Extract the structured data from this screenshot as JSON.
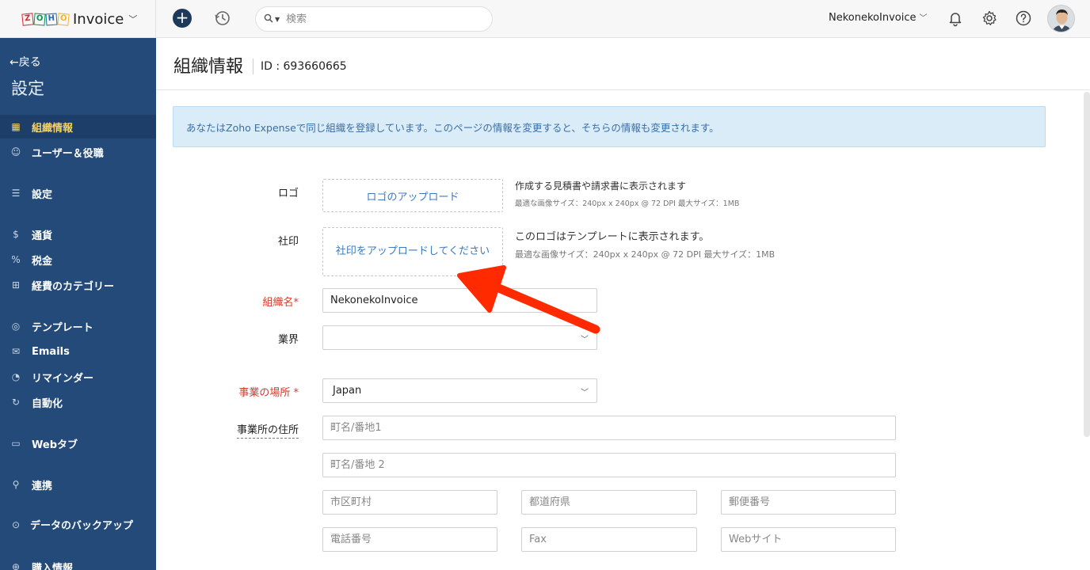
{
  "app": {
    "logo_letters": [
      "Z",
      "O",
      "H",
      "O"
    ],
    "name": "Invoice",
    "org_name": "NekonekoInvoice"
  },
  "topbar": {
    "search_placeholder": "検索"
  },
  "sidebar": {
    "back_label": "←戻る",
    "title": "設定",
    "items": [
      {
        "label": "組織情報",
        "icon": "building-icon",
        "active": true
      },
      {
        "label": "ユーザー＆役職",
        "icon": "users-icon"
      },
      {
        "label": "設定",
        "icon": "sliders-icon"
      },
      {
        "label": "通貨",
        "icon": "currency-icon"
      },
      {
        "label": "税金",
        "icon": "percent-icon"
      },
      {
        "label": "経費のカテゴリー",
        "icon": "category-icon"
      },
      {
        "label": "テンプレート",
        "icon": "template-icon"
      },
      {
        "label": "Emails",
        "icon": "mail-icon"
      },
      {
        "label": "リマインダー",
        "icon": "bell-icon"
      },
      {
        "label": "自動化",
        "icon": "refresh-icon"
      },
      {
        "label": "Webタブ",
        "icon": "window-icon"
      },
      {
        "label": "連携",
        "icon": "plug-icon"
      },
      {
        "label": "データのバックアップ",
        "icon": "backup-icon"
      },
      {
        "label": "購入情報",
        "icon": "cart-icon"
      }
    ]
  },
  "page": {
    "title": "組織情報",
    "id_label": "ID : 693660665",
    "info_message": "あなたはZoho Expenseで同じ組織を登録しています。このページの情報を変更すると、そちらの情報も変更されます。"
  },
  "form": {
    "logo": {
      "label": "ロゴ",
      "upload_label": "ロゴのアップロード",
      "hint": "作成する見積書や請求書に表示されます",
      "size_hint": "最適な画像サイズ：240px x 240px @ 72 DPI 最大サイズ：1MB"
    },
    "seal": {
      "label": "社印",
      "upload_label": "社印をアップロードしてください",
      "hint": "このロゴはテンプレートに表示されます。",
      "size_hint": "最適な画像サイズ：240px x 240px @ 72 DPI 最大サイズ：1MB"
    },
    "org_name": {
      "label": "組織名*",
      "value": "NekonekoInvoice"
    },
    "industry": {
      "label": "業界",
      "value": ""
    },
    "location": {
      "label": "事業の場所 *",
      "value": "Japan"
    },
    "address": {
      "label": "事業所の住所",
      "street1_placeholder": "町名/番地1",
      "street2_placeholder": "町名/番地 2",
      "city_placeholder": "市区町村",
      "state_placeholder": "都道府県",
      "zip_placeholder": "郵便番号",
      "phone_placeholder": "電話番号",
      "fax_placeholder": "Fax",
      "website_placeholder": "Webサイト"
    }
  },
  "colors": {
    "sidebar_bg": "#234a78",
    "active_text": "#f3d36b",
    "link_blue": "#3b7ac0",
    "required_red": "#d33a2c",
    "annotation_arrow": "#ff2a00"
  }
}
